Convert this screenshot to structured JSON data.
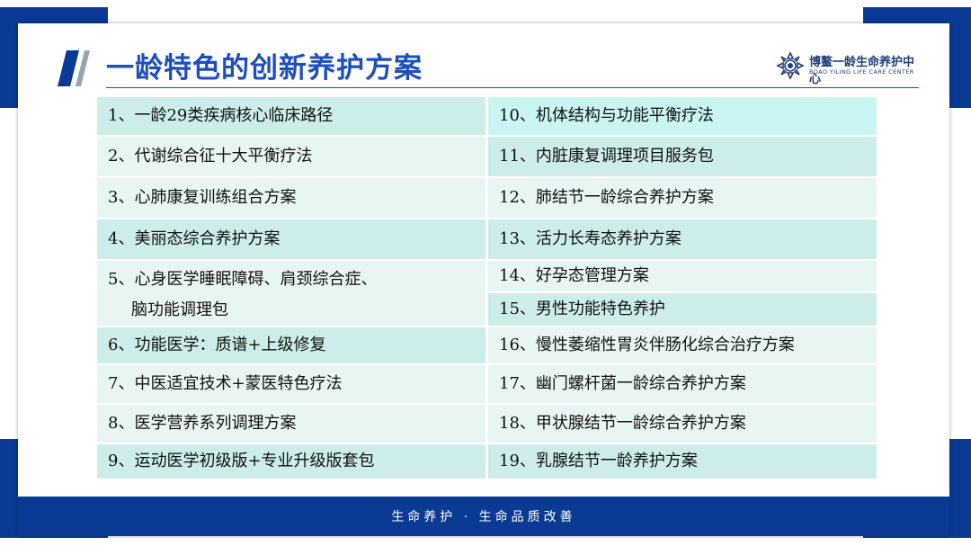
{
  "title": "一龄特色的创新养护方案",
  "logo": {
    "cn": "博鳌一龄生命养护中心",
    "en": "BOAO YILING LIFE CARE CENTER"
  },
  "left_items": [
    "1、一龄29类疾病核心临床路径",
    "2、代谢综合征十大平衡疗法",
    "3、心肺康复训练组合方案",
    "4、美丽态综合养护方案",
    "5、心身医学睡眠障碍、肩颈综合症、",
    "脑功能调理包",
    "6、功能医学：质谱+上级修复",
    "7、中医适宜技术+蒙医特色疗法",
    "8、医学营养系列调理方案",
    "9、运动医学初级版+专业升级版套包"
  ],
  "right_items": [
    "10、机体结构与功能平衡疗法",
    "11、内脏康复调理项目服务包",
    "12、肺结节一龄综合养护方案",
    "13、活力长寿态养护方案",
    "14、好孕态管理方案",
    "15、男性功能特色养护",
    "16、慢性萎缩性胃炎伴肠化综合治疗方案",
    "17、幽门螺杆菌一龄综合养护方案",
    "18、甲状腺结节一龄综合养护方案",
    "19、乳腺结节一龄养护方案"
  ],
  "footer": "生命养护 · 生命品质改善",
  "colors": {
    "brand_blue": "#0a3a94",
    "title_blue": "#1f4fbd",
    "cyan_row": "#c9f5f5",
    "teal_row": "#ccedea",
    "mint_row": "#e8f6f3"
  }
}
